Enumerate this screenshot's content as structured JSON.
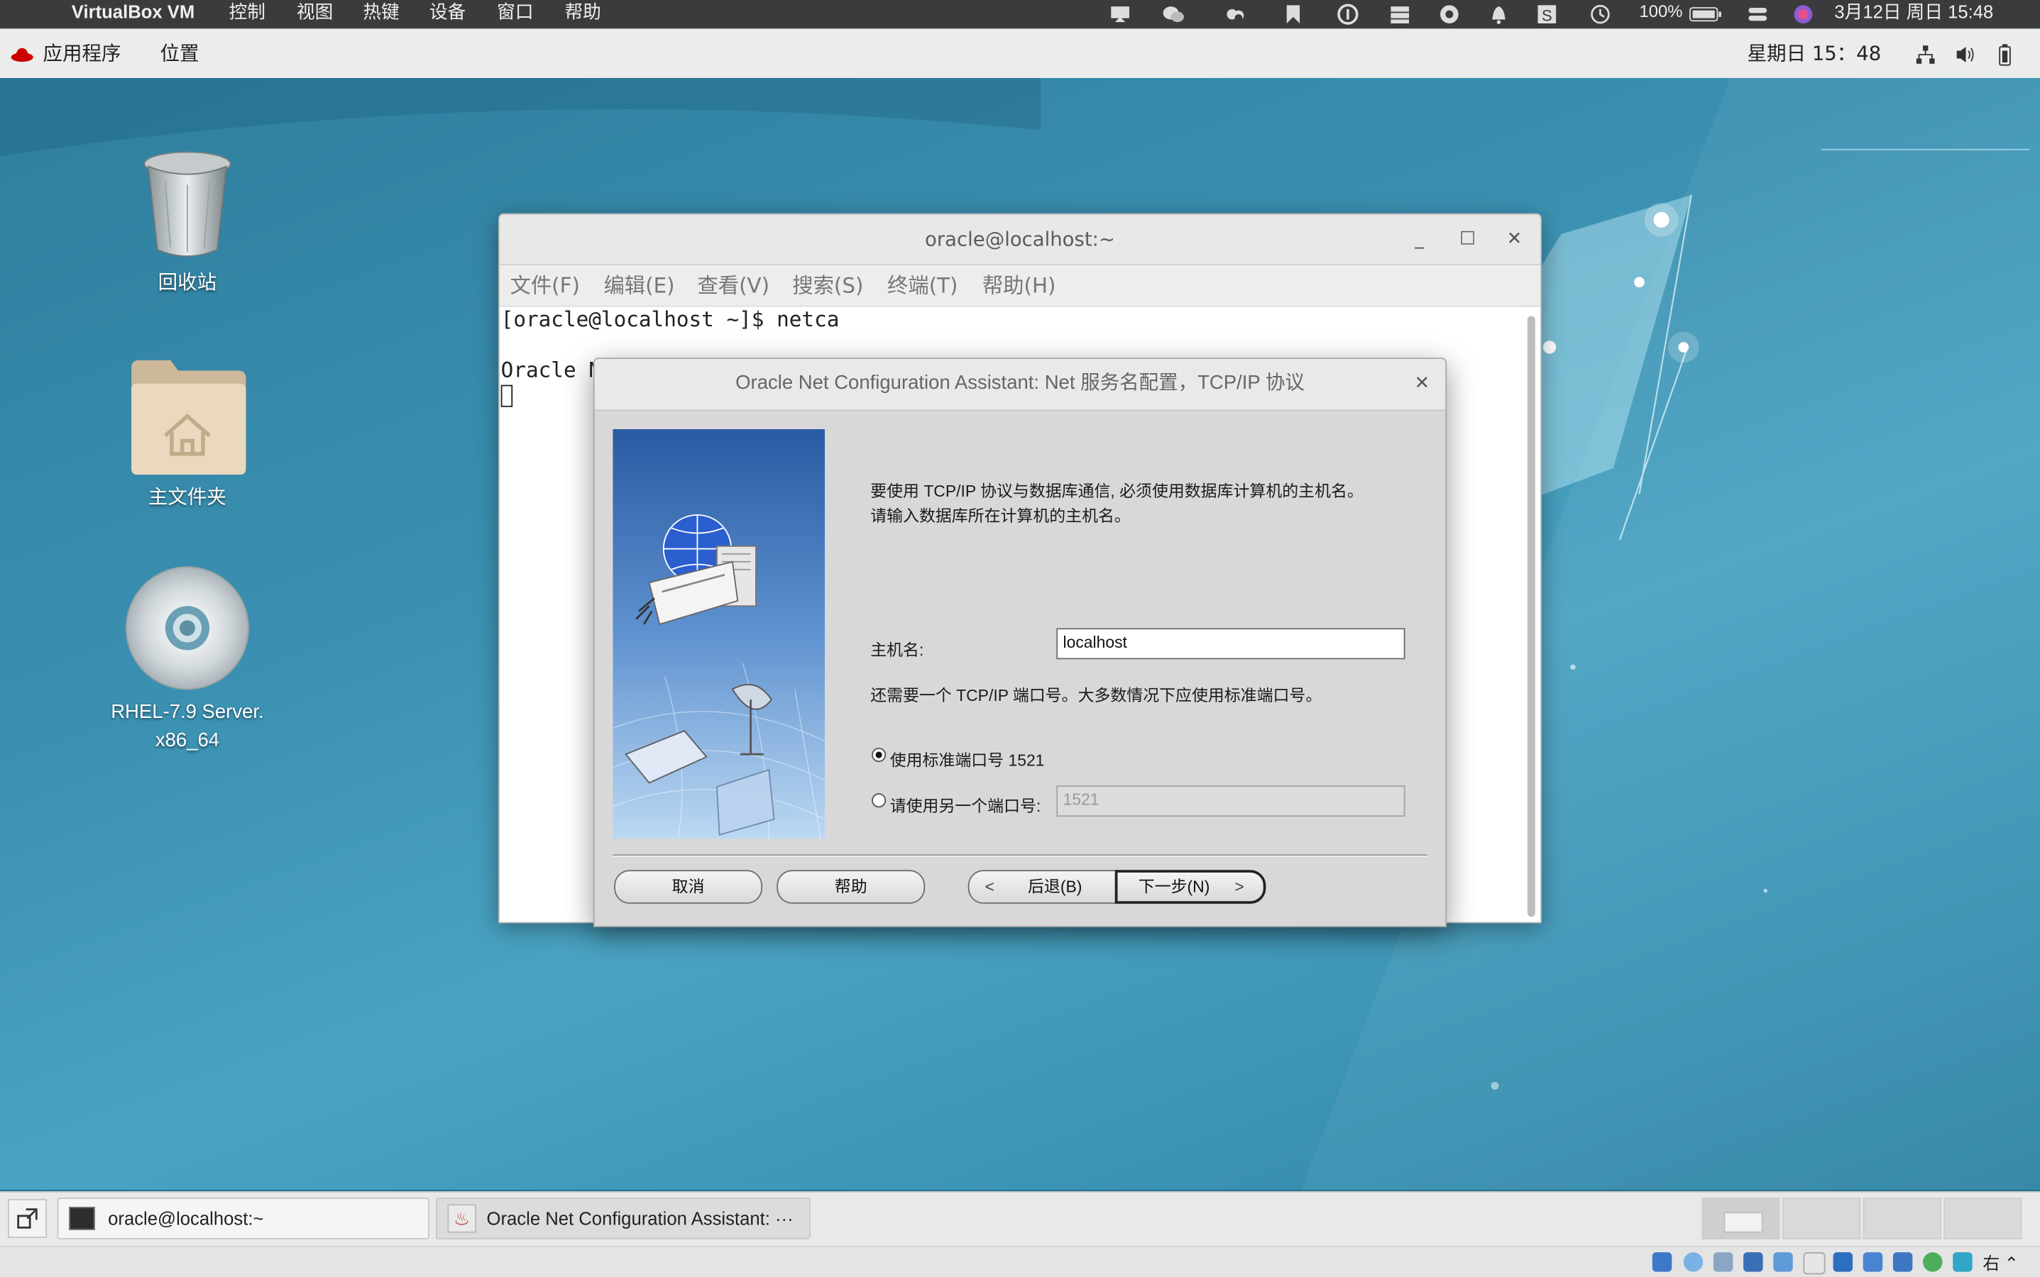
{
  "mac_menubar": {
    "app_name": "VirtualBox VM",
    "menus": [
      "控制",
      "视图",
      "热键",
      "设备",
      "窗口",
      "帮助"
    ],
    "battery_percent": "100%",
    "datetime": "3月12日 周日 15:48",
    "tray_icons": [
      "notification-icon",
      "wechat-icon",
      "cloud-icon",
      "bookmark-icon",
      "1password-icon",
      "server-icon",
      "vpn-icon",
      "bell-icon",
      "s-icon",
      "time-machine-icon",
      "battery-icon",
      "control-center-icon",
      "siri-icon"
    ]
  },
  "gnome_topbar": {
    "applications": "应用程序",
    "places": "位置",
    "clock": "星期日 15：48"
  },
  "desktop_icons": [
    {
      "label": "回收站"
    },
    {
      "label": "主文件夹"
    },
    {
      "label": "RHEL-7.9 Server.\nx86_64"
    }
  ],
  "terminal": {
    "title": "oracle@localhost:~",
    "menus": [
      "文件(F)",
      "编辑(E)",
      "查看(V)",
      "搜索(S)",
      "终端(T)",
      "帮助(H)"
    ],
    "lines": [
      "[oracle@localhost ~]$ netca",
      "",
      "Oracle N"
    ]
  },
  "dialog": {
    "title": "Oracle Net Configuration Assistant: Net 服务名配置，TCP/IP 协议",
    "intro_line1": "要使用 TCP/IP 协议与数据库通信, 必须使用数据库计算机的主机名。",
    "intro_line2": "请输入数据库所在计算机的主机名。",
    "hostname_label": "主机名:",
    "hostname_value": "localhost",
    "port_hint": "还需要一个 TCP/IP 端口号。大多数情况下应使用标准端口号。",
    "radio_standard_label": "使用标准端口号 1521",
    "radio_other_label": "请使用另一个端口号:",
    "other_port_value": "1521",
    "selected_option": "standard",
    "buttons": {
      "cancel": "取消",
      "help": "帮助",
      "back": "后退(B)",
      "next": "下一步(N)"
    }
  },
  "taskbar": {
    "items": [
      {
        "label": "oracle@localhost:~"
      },
      {
        "label": "Oracle Net Configuration Assistant: ···"
      }
    ]
  },
  "vbox_status": {
    "host_key": "右 ⌃"
  }
}
